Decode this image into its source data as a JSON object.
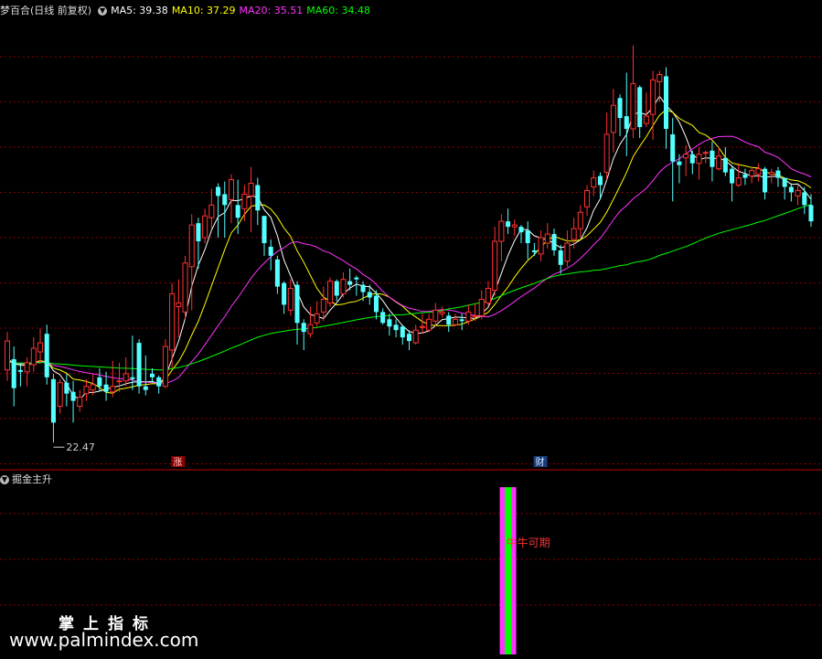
{
  "header": {
    "stock_label": "梦百合(日线 前复权)",
    "ma5": "MA5: 39.38",
    "ma10": "MA10: 37.29",
    "ma20": "MA20: 35.51",
    "ma60": "MA60: 34.48",
    "colors": {
      "ma5": "#ffffff",
      "ma10": "#ffff00",
      "ma20": "#ff33ff",
      "ma60": "#00ff00"
    }
  },
  "indicator_label": "掘金主升",
  "watermark": {
    "title": "掌上指标",
    "url": "www.palmindex.com"
  },
  "chart_data": [
    {
      "type": "candlestick",
      "title": "梦百合(日线 前复权)",
      "ylim": [
        21.2,
        46.0
      ],
      "grid": true,
      "annotations": {
        "low_label": "22.47",
        "marker_zhang": "涨",
        "marker_cai": "财"
      },
      "candles": [
        [
          26.5,
          28.1,
          25.9,
          28.6
        ],
        [
          27.1,
          25.5,
          24.5,
          27.8
        ],
        [
          26.5,
          26.4,
          25.6,
          26.9
        ],
        [
          26.4,
          26.9,
          25.6,
          27.2
        ],
        [
          26.8,
          27.7,
          26.4,
          28.3
        ],
        [
          27.5,
          28.0,
          26.9,
          28.8
        ],
        [
          28.5,
          26.1,
          25.7,
          29.0
        ],
        [
          26.0,
          23.6,
          22.5,
          26.3
        ],
        [
          24.5,
          25.8,
          24.1,
          26.0
        ],
        [
          25.8,
          25.2,
          24.5,
          26.3
        ],
        [
          25.3,
          24.8,
          23.6,
          25.9
        ],
        [
          24.5,
          25.0,
          24.2,
          25.4
        ],
        [
          25.2,
          25.6,
          24.8,
          26.0
        ],
        [
          25.4,
          25.7,
          25.1,
          26.3
        ],
        [
          26.1,
          25.6,
          25.3,
          26.6
        ],
        [
          25.7,
          25.3,
          24.8,
          26.4
        ],
        [
          25.3,
          25.6,
          25.0,
          27.0
        ],
        [
          25.9,
          25.9,
          25.3,
          26.9
        ],
        [
          25.9,
          26.3,
          25.6,
          27.2
        ],
        [
          26.1,
          26.0,
          25.4,
          28.4
        ],
        [
          28.0,
          25.6,
          25.2,
          28.2
        ],
        [
          25.6,
          25.4,
          25.1,
          27.3
        ],
        [
          26.3,
          26.1,
          25.8,
          26.6
        ],
        [
          26.1,
          25.6,
          25.2,
          26.2
        ],
        [
          25.6,
          27.8,
          25.5,
          28.2
        ],
        [
          27.6,
          30.7,
          26.6,
          31.3
        ],
        [
          30.0,
          30.2,
          28.3,
          31.5
        ],
        [
          29.7,
          32.4,
          29.3,
          32.8
        ],
        [
          32.2,
          34.5,
          29.8,
          35.1
        ],
        [
          34.6,
          33.6,
          32.1,
          34.9
        ],
        [
          33.8,
          35.0,
          33.5,
          35.4
        ],
        [
          34.9,
          35.6,
          34.3,
          36.5
        ],
        [
          36.6,
          36.1,
          33.8,
          36.8
        ],
        [
          36.2,
          35.6,
          33.8,
          36.9
        ],
        [
          35.9,
          37.0,
          34.6,
          37.3
        ],
        [
          35.6,
          34.9,
          34.0,
          37.0
        ],
        [
          35.4,
          36.2,
          34.7,
          36.7
        ],
        [
          36.1,
          36.8,
          34.1,
          37.7
        ],
        [
          36.7,
          35.3,
          34.5,
          37.1
        ],
        [
          35.0,
          33.5,
          32.8,
          35.0
        ],
        [
          33.3,
          32.8,
          32.0,
          33.7
        ],
        [
          32.6,
          31.1,
          30.7,
          32.8
        ],
        [
          31.3,
          30.1,
          29.6,
          31.4
        ],
        [
          29.8,
          31.0,
          29.5,
          31.5
        ],
        [
          31.2,
          29.1,
          27.9,
          31.4
        ],
        [
          29.1,
          28.6,
          27.6,
          29.3
        ],
        [
          28.5,
          29.0,
          28.3,
          30.0
        ],
        [
          29.1,
          29.6,
          28.9,
          30.3
        ],
        [
          29.7,
          30.4,
          29.2,
          31.1
        ],
        [
          30.2,
          31.4,
          30.0,
          31.6
        ],
        [
          31.4,
          30.6,
          30.3,
          31.5
        ],
        [
          30.7,
          31.5,
          30.5,
          31.9
        ],
        [
          31.4,
          31.2,
          30.9,
          32.1
        ],
        [
          31.6,
          31.5,
          30.6,
          31.7
        ],
        [
          31.2,
          30.8,
          30.3,
          31.4
        ],
        [
          30.8,
          30.5,
          30.1,
          31.2
        ],
        [
          30.6,
          29.7,
          29.3,
          30.9
        ],
        [
          29.7,
          29.1,
          29.0,
          29.9
        ],
        [
          29.3,
          28.9,
          28.4,
          29.6
        ],
        [
          29.0,
          28.7,
          28.3,
          29.3
        ],
        [
          28.9,
          28.3,
          27.9,
          29.0
        ],
        [
          28.5,
          28.1,
          27.6,
          28.7
        ],
        [
          28.0,
          28.7,
          27.9,
          29.0
        ],
        [
          28.9,
          28.9,
          28.5,
          29.6
        ],
        [
          28.7,
          29.3,
          28.6,
          29.6
        ],
        [
          29.2,
          29.8,
          28.9,
          30.2
        ],
        [
          29.6,
          29.7,
          29.4,
          30.0
        ],
        [
          29.5,
          29.0,
          28.6,
          29.7
        ],
        [
          29.0,
          29.3,
          28.9,
          29.6
        ],
        [
          29.3,
          29.2,
          28.7,
          29.6
        ],
        [
          29.2,
          29.7,
          29.0,
          30.1
        ],
        [
          29.5,
          29.5,
          29.2,
          30.2
        ],
        [
          29.5,
          30.4,
          29.3,
          30.9
        ],
        [
          30.2,
          31.0,
          30.0,
          31.4
        ],
        [
          30.9,
          33.6,
          30.6,
          34.4
        ],
        [
          33.6,
          34.7,
          32.5,
          35.1
        ],
        [
          34.7,
          34.4,
          34.0,
          35.4
        ],
        [
          34.4,
          34.5,
          33.9,
          34.8
        ],
        [
          34.4,
          34.1,
          33.5,
          34.5
        ],
        [
          34.2,
          33.5,
          32.6,
          34.7
        ],
        [
          33.1,
          33.0,
          32.8,
          33.5
        ],
        [
          32.9,
          33.8,
          32.5,
          34.2
        ],
        [
          33.5,
          34.0,
          33.2,
          34.6
        ],
        [
          34.0,
          33.1,
          32.8,
          34.3
        ],
        [
          33.1,
          32.3,
          31.8,
          33.4
        ],
        [
          32.5,
          33.5,
          32.2,
          34.2
        ],
        [
          33.7,
          34.3,
          33.2,
          34.9
        ],
        [
          34.3,
          35.2,
          33.8,
          35.6
        ],
        [
          35.5,
          36.4,
          35.0,
          36.7
        ],
        [
          36.6,
          37.1,
          36.1,
          37.5
        ],
        [
          37.2,
          36.7,
          35.9,
          37.4
        ],
        [
          37.4,
          39.5,
          37.0,
          40.7
        ],
        [
          39.6,
          41.1,
          38.5,
          42.0
        ],
        [
          41.5,
          40.4,
          39.4,
          41.7
        ],
        [
          40.5,
          39.8,
          38.3,
          42.9
        ],
        [
          39.8,
          42.3,
          39.3,
          44.4
        ],
        [
          42.1,
          39.9,
          39.3,
          42.2
        ],
        [
          40.1,
          40.5,
          39.9,
          41.8
        ],
        [
          40.6,
          42.5,
          39.2,
          43.0
        ],
        [
          42.4,
          42.8,
          41.3,
          43.0
        ],
        [
          42.7,
          39.8,
          38.7,
          43.2
        ],
        [
          39.5,
          38.0,
          35.8,
          40.4
        ],
        [
          38.0,
          37.8,
          36.8,
          38.4
        ],
        [
          38.2,
          38.4,
          37.2,
          38.9
        ],
        [
          38.4,
          37.9,
          37.3,
          38.6
        ],
        [
          37.9,
          38.4,
          37.0,
          38.8
        ],
        [
          38.5,
          38.5,
          37.9,
          38.6
        ],
        [
          38.6,
          37.7,
          36.9,
          39.1
        ],
        [
          37.6,
          38.3,
          37.5,
          38.8
        ],
        [
          38.2,
          37.4,
          37.2,
          38.8
        ],
        [
          37.6,
          36.8,
          35.8,
          37.8
        ],
        [
          36.7,
          37.1,
          36.6,
          37.9
        ],
        [
          37.3,
          37.1,
          36.7,
          37.6
        ],
        [
          37.2,
          37.5,
          36.8,
          37.7
        ],
        [
          37.3,
          37.6,
          36.9,
          37.9
        ],
        [
          37.6,
          36.3,
          35.9,
          37.7
        ],
        [
          37.3,
          37.4,
          36.8,
          37.6
        ],
        [
          37.5,
          37.1,
          36.6,
          37.7
        ],
        [
          37.1,
          36.6,
          35.9,
          37.1
        ],
        [
          36.6,
          36.3,
          35.8,
          36.8
        ],
        [
          36.1,
          36.4,
          35.6,
          36.7
        ],
        [
          36.3,
          35.6,
          35.1,
          36.6
        ],
        [
          35.6,
          34.7,
          34.4,
          36.2
        ]
      ],
      "series": [
        {
          "name": "MA5",
          "color": "#ffffff"
        },
        {
          "name": "MA10",
          "color": "#ffff00"
        },
        {
          "name": "MA20",
          "color": "#ff33ff"
        },
        {
          "name": "MA60",
          "color": "#00ff00"
        }
      ]
    },
    {
      "type": "bar",
      "title": "掘金主升",
      "signal_index": 76,
      "signal_text": "牛牛可期",
      "colors": [
        "#ff33ff",
        "#00ff00"
      ]
    }
  ]
}
